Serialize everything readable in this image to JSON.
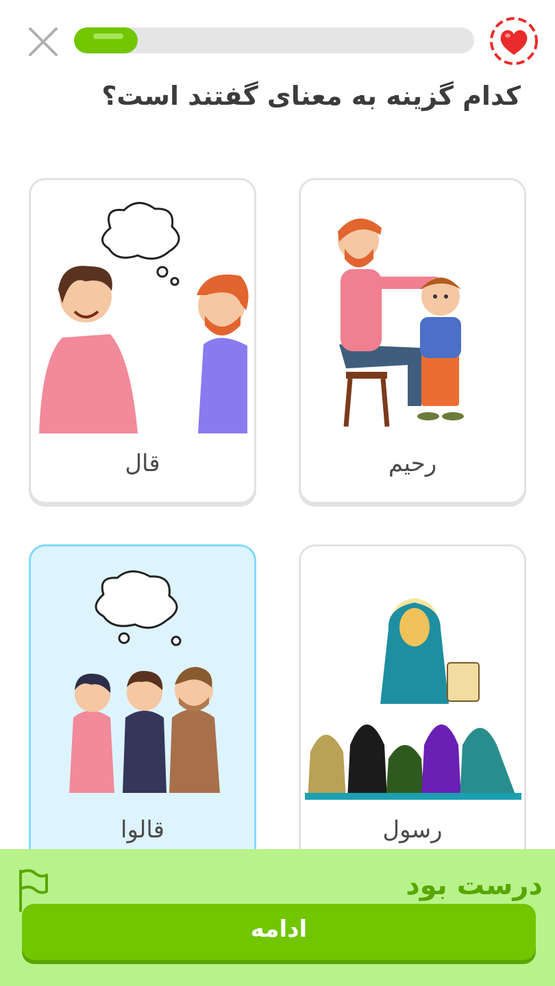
{
  "progress": {
    "fraction": 0.16
  },
  "question": "کدام گزینه به معنای گفتند است؟",
  "options": [
    {
      "label": "رحیم",
      "selected": false
    },
    {
      "label": "قال",
      "selected": false
    },
    {
      "label": "رسول",
      "selected": false
    },
    {
      "label": "قالوا",
      "selected": true
    }
  ],
  "footer": {
    "feedback": "درست بود",
    "continue_label": "ادامه"
  },
  "colors": {
    "accent": "#72c600",
    "footer_bg": "#b8f28b",
    "feedback_text": "#58a700",
    "selected_bg": "#ddf4ff",
    "selected_border": "#84d8ff",
    "heart": "#ea2b2b"
  },
  "icons": [
    "close-icon",
    "heart-icon",
    "flag-icon"
  ]
}
